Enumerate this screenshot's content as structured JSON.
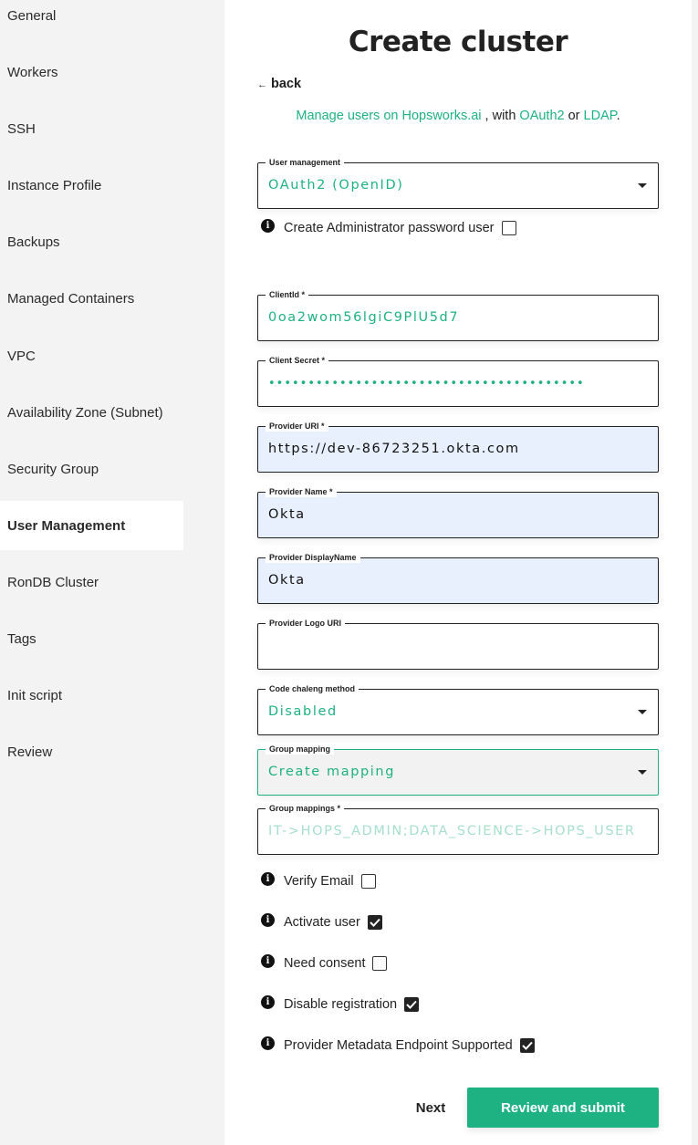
{
  "sidebar": {
    "items": [
      {
        "label": "General",
        "active": false
      },
      {
        "label": "Workers",
        "active": false
      },
      {
        "label": "SSH",
        "active": false
      },
      {
        "label": "Instance Profile",
        "active": false
      },
      {
        "label": "Backups",
        "active": false
      },
      {
        "label": "Managed Containers",
        "active": false
      },
      {
        "label": "VPC",
        "active": false
      },
      {
        "label": "Availability Zone (Subnet)",
        "active": false
      },
      {
        "label": "Security Group",
        "active": false
      },
      {
        "label": "User Management",
        "active": true
      },
      {
        "label": "RonDB Cluster",
        "active": false
      },
      {
        "label": "Tags",
        "active": false
      },
      {
        "label": "Init script",
        "active": false
      },
      {
        "label": "Review",
        "active": false
      }
    ]
  },
  "header": {
    "title": "Create cluster",
    "back_arrow": "←",
    "back_label": "back",
    "subtitle": {
      "link1": "Manage users on Hopsworks.ai",
      "text1": " , with ",
      "link2": "OAuth2",
      "text2": " or ",
      "link3": "LDAP",
      "text3": "."
    }
  },
  "form": {
    "user_management": {
      "label": "User management",
      "value": "OAuth2 (OpenID)"
    },
    "create_admin": {
      "label": "Create Administrator password user",
      "checked": false
    },
    "client_id": {
      "label": "ClientId *",
      "value": "0oa2wom56lgiC9PlU5d7"
    },
    "client_secret": {
      "label": "Client Secret *",
      "value": "••••••••••••••••••••••••••••••••••••••••"
    },
    "provider_uri": {
      "label": "Provider URI *",
      "value": "https://dev-86723251.okta.com"
    },
    "provider_name": {
      "label": "Provider Name *",
      "value": "Okta"
    },
    "provider_display_name": {
      "label": "Provider DisplayName",
      "value": "Okta"
    },
    "provider_logo_uri": {
      "label": "Provider Logo URI",
      "value": ""
    },
    "code_challenge_method": {
      "label": "Code chaleng method",
      "value": "Disabled"
    },
    "group_mapping": {
      "label": "Group mapping",
      "value": "Create mapping"
    },
    "group_mappings": {
      "label": "Group mappings *",
      "placeholder": "IT->HOPS_ADMIN;DATA_SCIENCE->HOPS_USER"
    },
    "checkboxes": [
      {
        "label": "Verify Email",
        "checked": false
      },
      {
        "label": "Activate user",
        "checked": true
      },
      {
        "label": "Need consent",
        "checked": false
      },
      {
        "label": "Disable registration",
        "checked": true
      },
      {
        "label": "Provider Metadata Endpoint Supported",
        "checked": true
      }
    ]
  },
  "footer": {
    "next_label": "Next",
    "submit_label": "Review and submit"
  },
  "colors": {
    "accent": "#1eb182",
    "autofill_bg": "#e8f0fe",
    "sidebar_bg": "#f3f3f3"
  }
}
